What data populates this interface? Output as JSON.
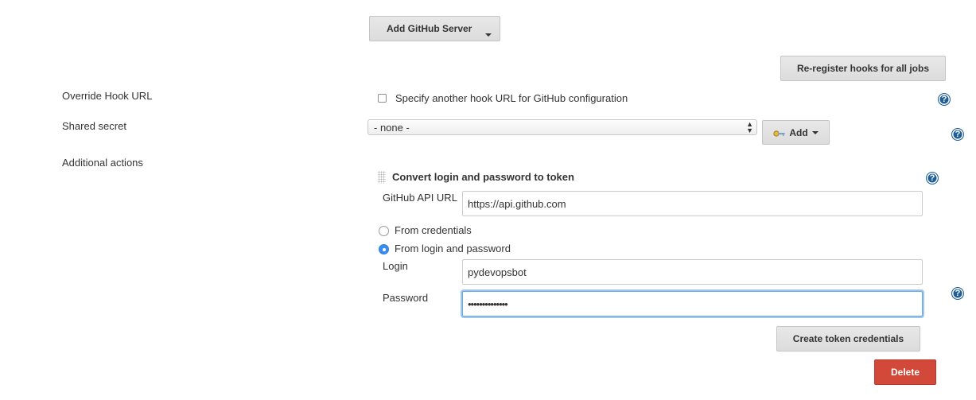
{
  "github_server": {
    "add_button": "Add GitHub Server",
    "reregister_button": "Re-register hooks for all jobs"
  },
  "override_hook": {
    "label": "Override Hook URL",
    "checkbox_label": "Specify another hook URL for GitHub configuration",
    "checked": false
  },
  "shared_secret": {
    "label": "Shared secret",
    "selected": "- none -",
    "add_button": "Add"
  },
  "additional_actions": {
    "label": "Additional actions",
    "section_title": "Convert login and password to token",
    "api_url_label": "GitHub API URL",
    "api_url_value": "https://api.github.com",
    "radio_from_credentials": "From credentials",
    "radio_from_login": "From login and password",
    "selected_radio": "From login and password",
    "login_label": "Login",
    "login_value": "pydevopsbot",
    "password_label": "Password",
    "password_value": "••••••••••••••",
    "create_button": "Create token credentials",
    "delete_button": "Delete"
  },
  "icons": {
    "help": "help-icon",
    "key": "key-icon",
    "drag": "drag-handle-icon"
  },
  "colors": {
    "help": "#1f5f96",
    "delete": "#d24939",
    "focus": "#9cc7f0",
    "radio_selected": "#3b8cf0"
  }
}
